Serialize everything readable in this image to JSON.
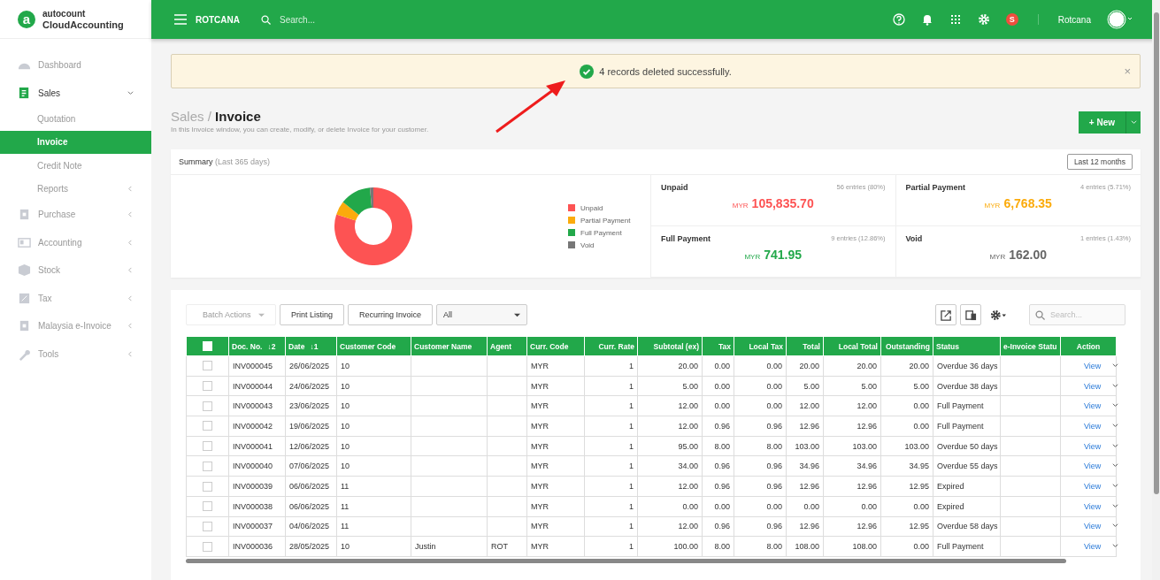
{
  "brand": {
    "top": "autocount",
    "bottom": "CloudAccounting",
    "mark": "a"
  },
  "sidebar": {
    "items": [
      {
        "label": "Dashboard",
        "kind": "link"
      },
      {
        "label": "Sales",
        "kind": "group",
        "expanded": true,
        "children": [
          {
            "label": "Quotation",
            "kind": "link",
            "selected": false
          },
          {
            "label": "Invoice",
            "kind": "link",
            "selected": true
          },
          {
            "label": "Credit Note",
            "kind": "link",
            "selected": false
          },
          {
            "label": "Reports",
            "kind": "group",
            "selected": false
          }
        ]
      },
      {
        "label": "Purchase",
        "kind": "group",
        "expanded": false
      },
      {
        "label": "Accounting",
        "kind": "group",
        "expanded": false
      },
      {
        "label": "Stock",
        "kind": "group",
        "expanded": false
      },
      {
        "label": "Tax",
        "kind": "group",
        "expanded": false
      },
      {
        "label": "Malaysia e-Invoice",
        "kind": "group",
        "expanded": false
      },
      {
        "label": "Tools",
        "kind": "group",
        "expanded": false
      }
    ]
  },
  "topbar": {
    "company": "ROTCANA",
    "search_placeholder": "Search...",
    "badge": "S",
    "user": "Rotcana"
  },
  "alert": {
    "message": "4 records deleted successfully.",
    "close": "×"
  },
  "page": {
    "breadcrumb": "Sales",
    "separator": "/",
    "title": "Invoice",
    "description": "In this Invoice window, you can create, modify, or delete Invoice for your customer.",
    "new_button": "New",
    "new_plus": "+"
  },
  "summary": {
    "title": "Summary",
    "period": "(Last 365 days)",
    "range_button": "Last 12 months",
    "chart_data": {
      "type": "donut",
      "categories": [
        "Unpaid",
        "Partial Payment",
        "Full Payment",
        "Void"
      ],
      "values": [
        80,
        5.71,
        12.86,
        1.43
      ]
    },
    "legend": [
      {
        "color": "#fd5353"
      },
      {
        "color": "#fbab0c"
      },
      {
        "color": "#22a84a"
      },
      {
        "color": "#777777"
      }
    ],
    "cards": [
      {
        "title": "Unpaid",
        "entries": "56 entries (80%)",
        "currency": "MYR",
        "amount": "105,835.70",
        "color": "#fd5353"
      },
      {
        "title": "Partial Payment",
        "entries": "4 entries (5.71%)",
        "currency": "MYR",
        "amount": "6,768.35",
        "color": "#fbab0c"
      },
      {
        "title": "Full Payment",
        "entries": "9 entries (12.86%)",
        "currency": "MYR",
        "amount": "741.95",
        "color": "#22a84a"
      },
      {
        "title": "Void",
        "entries": "1 entries (1.43%)",
        "currency": "MYR",
        "amount": "162.00",
        "color": "#666666"
      }
    ]
  },
  "toolbar": {
    "batch": {
      "label": "Batch Actions",
      "disabled": true
    },
    "buttons": [
      "Print Listing",
      "Recurring Invoice"
    ],
    "filter": "All",
    "search_placeholder": "Search..."
  },
  "table": {
    "select_all_checked": false,
    "columns": [
      {
        "label": "Doc. No.",
        "sort": "↓2"
      },
      {
        "label": "Date",
        "sort": "↓1"
      },
      {
        "label": "Customer Code"
      },
      {
        "label": "Customer Name"
      },
      {
        "label": "Agent"
      },
      {
        "label": "Curr. Code"
      },
      {
        "label": "Curr. Rate"
      },
      {
        "label": "Subtotal (ex)"
      },
      {
        "label": "Tax"
      },
      {
        "label": "Local Tax"
      },
      {
        "label": "Total"
      },
      {
        "label": "Local Total"
      },
      {
        "label": "Outstanding"
      },
      {
        "label": "Status"
      },
      {
        "label": "e-Invoice Statu"
      },
      {
        "label": "Action"
      }
    ],
    "rows": [
      {
        "checked": false,
        "cells": [
          "INV000045",
          "26/06/2025",
          "10",
          "",
          "",
          "MYR",
          "1",
          "20.00",
          "0.00",
          "0.00",
          "20.00",
          "20.00",
          "20.00",
          "Overdue 36 days",
          ""
        ],
        "action": "View"
      },
      {
        "checked": false,
        "cells": [
          "INV000044",
          "24/06/2025",
          "10",
          "",
          "",
          "MYR",
          "1",
          "5.00",
          "0.00",
          "0.00",
          "5.00",
          "5.00",
          "5.00",
          "Overdue 38 days",
          ""
        ],
        "action": "View"
      },
      {
        "checked": false,
        "cells": [
          "INV000043",
          "23/06/2025",
          "10",
          "",
          "",
          "MYR",
          "1",
          "12.00",
          "0.00",
          "0.00",
          "12.00",
          "12.00",
          "0.00",
          "Full Payment",
          ""
        ],
        "action": "View"
      },
      {
        "checked": false,
        "cells": [
          "INV000042",
          "19/06/2025",
          "10",
          "",
          "",
          "MYR",
          "1",
          "12.00",
          "0.96",
          "0.96",
          "12.96",
          "12.96",
          "0.00",
          "Full Payment",
          ""
        ],
        "action": "View"
      },
      {
        "checked": false,
        "cells": [
          "INV000041",
          "12/06/2025",
          "10",
          "",
          "",
          "MYR",
          "1",
          "95.00",
          "8.00",
          "8.00",
          "103.00",
          "103.00",
          "103.00",
          "Overdue 50 days",
          ""
        ],
        "action": "View"
      },
      {
        "checked": false,
        "cells": [
          "INV000040",
          "07/06/2025",
          "10",
          "",
          "",
          "MYR",
          "1",
          "34.00",
          "0.96",
          "0.96",
          "34.96",
          "34.96",
          "34.95",
          "Overdue 55 days",
          ""
        ],
        "action": "View"
      },
      {
        "checked": false,
        "cells": [
          "INV000039",
          "06/06/2025",
          "11",
          "",
          "",
          "MYR",
          "1",
          "12.00",
          "0.96",
          "0.96",
          "12.96",
          "12.96",
          "12.95",
          "Expired",
          ""
        ],
        "action": "View"
      },
      {
        "checked": false,
        "cells": [
          "INV000038",
          "06/06/2025",
          "11",
          "",
          "",
          "MYR",
          "1",
          "0.00",
          "0.00",
          "0.00",
          "0.00",
          "0.00",
          "0.00",
          "Expired",
          ""
        ],
        "action": "View"
      },
      {
        "checked": false,
        "cells": [
          "INV000037",
          "04/06/2025",
          "11",
          "",
          "",
          "MYR",
          "1",
          "12.00",
          "0.96",
          "0.96",
          "12.96",
          "12.96",
          "12.95",
          "Overdue 58 days",
          ""
        ],
        "action": "View"
      },
      {
        "checked": false,
        "cells": [
          "INV000036",
          "28/05/2025",
          "10",
          "Justin",
          "ROT",
          "MYR",
          "1",
          "100.00",
          "8.00",
          "8.00",
          "108.00",
          "108.00",
          "0.00",
          "Full Payment",
          ""
        ],
        "action": "View"
      }
    ]
  }
}
